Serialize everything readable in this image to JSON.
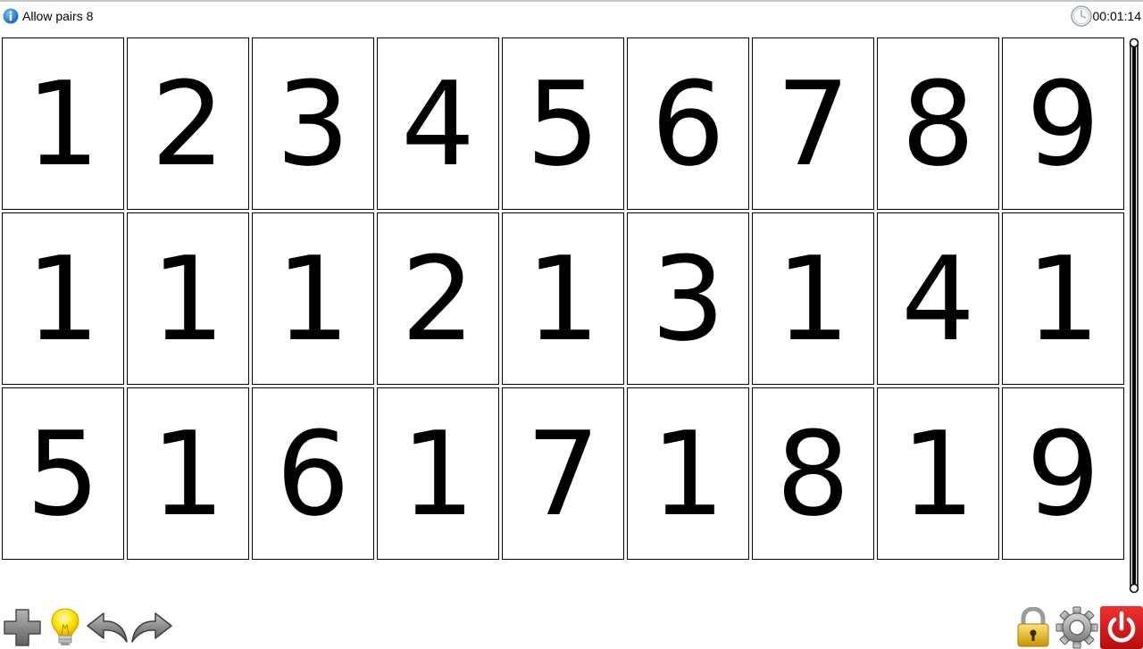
{
  "status": {
    "message": "Allow pairs 8",
    "timer": "00:01:14",
    "info_icon": "info-icon",
    "clock_icon": "clock-icon"
  },
  "board": {
    "rows": [
      [
        "1",
        "2",
        "3",
        "4",
        "5",
        "6",
        "7",
        "8",
        "9"
      ],
      [
        "1",
        "1",
        "1",
        "2",
        "1",
        "3",
        "1",
        "4",
        "1"
      ],
      [
        "5",
        "1",
        "6",
        "1",
        "7",
        "1",
        "8",
        "1",
        "9"
      ]
    ]
  },
  "toolbar": {
    "left": [
      "plus-icon",
      "lightbulb-icon",
      "undo-icon",
      "redo-icon"
    ],
    "right": [
      "lock-icon",
      "gear-icon",
      "power-icon"
    ]
  },
  "colors": {
    "info_blue": "#1e88e5",
    "bulb_yellow": "#ffe600",
    "lock_gold": "#e0b020",
    "power_red": "#d81818",
    "icon_gray": "#8a8a8a"
  }
}
